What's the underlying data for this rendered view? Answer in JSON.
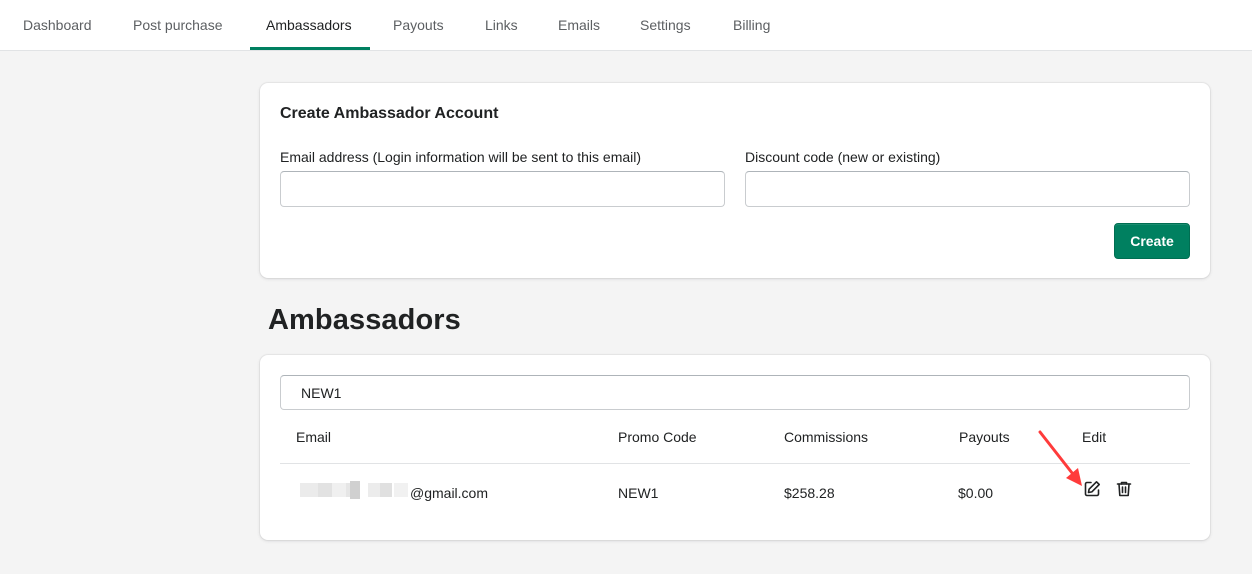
{
  "nav": {
    "tabs": [
      {
        "label": "Dashboard"
      },
      {
        "label": "Post purchase"
      },
      {
        "label": "Ambassadors"
      },
      {
        "label": "Payouts"
      },
      {
        "label": "Links"
      },
      {
        "label": "Emails"
      },
      {
        "label": "Settings"
      },
      {
        "label": "Billing"
      }
    ],
    "active_tab": "Ambassadors"
  },
  "create_card": {
    "title": "Create Ambassador Account",
    "email_label": "Email address (Login information will be sent to this email)",
    "email_value": "",
    "discount_label": "Discount code (new or existing)",
    "discount_value": "",
    "create_button": "Create"
  },
  "ambassadors": {
    "heading": "Ambassadors",
    "search_value": "NEW1",
    "columns": [
      "Email",
      "Promo Code",
      "Commissions",
      "Payouts",
      "Edit"
    ],
    "rows": [
      {
        "email_visible": "@gmail.com",
        "promo_code": "NEW1",
        "commissions": "$258.28",
        "payouts": "$0.00",
        "edit_icon": "edit-icon",
        "delete_icon": "trash-icon"
      }
    ]
  },
  "colors": {
    "primary": "#008060",
    "annotation_arrow": "#ff3b3b"
  }
}
